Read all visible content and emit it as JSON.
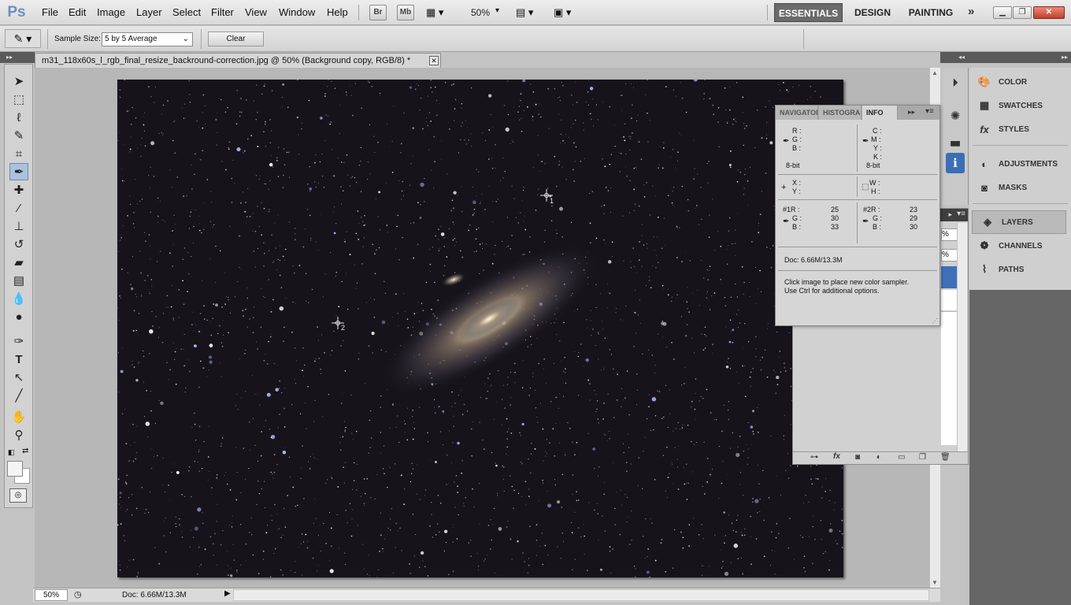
{
  "app": {
    "logo": "Ps"
  },
  "menu": [
    "File",
    "Edit",
    "Image",
    "Layer",
    "Select",
    "Filter",
    "View",
    "Window",
    "Help"
  ],
  "appbar": {
    "bridge": "Br",
    "minibridge": "Mb",
    "zoom": "50%"
  },
  "workspaces": [
    "ESSENTIALS",
    "DESIGN",
    "PAINTING"
  ],
  "options": {
    "sample_size_label": "Sample Size:",
    "sample_size_value": "5 by 5 Average",
    "clear_label": "Clear"
  },
  "document": {
    "tab_title": "m31_118x60s_l_rgb_final_resize_backround-correction.jpg @ 50% (Background copy, RGB/8) *"
  },
  "status": {
    "zoom": "50%",
    "doc": "Doc: 6.66M/13.3M"
  },
  "info_panel": {
    "tabs": [
      "NAVIGATOR",
      "HISTOGRAM",
      "INFO"
    ],
    "rgb": {
      "r": "R :",
      "g": "G :",
      "b": "B :",
      "bit": "8-bit"
    },
    "cmyk": {
      "c": "C :",
      "m": "M :",
      "y": "Y :",
      "k": "K :",
      "bit": "8-bit"
    },
    "xy": {
      "x": "X :",
      "y": "Y :"
    },
    "wh": {
      "w": "W :",
      "h": "H :"
    },
    "s1": {
      "r_label": "#1R :",
      "g_label": "G :",
      "b_label": "B :",
      "r": "25",
      "g": "30",
      "b": "33"
    },
    "s2": {
      "r_label": "#2R :",
      "g_label": "G :",
      "b_label": "B :",
      "r": "23",
      "g": "29",
      "b": "30"
    },
    "doc": "Doc: 6.66M/13.3M",
    "hint1": "Click image to place new color sampler.",
    "hint2": "Use Ctrl for additional options."
  },
  "dock": [
    "COLOR",
    "SWATCHES",
    "STYLES",
    "ADJUSTMENTS",
    "MASKS",
    "LAYERS",
    "CHANNELS",
    "PATHS"
  ],
  "layers": {
    "opacity_suffix": "%",
    "fill_suffix": "%"
  },
  "samplers": [
    "1",
    "2"
  ]
}
